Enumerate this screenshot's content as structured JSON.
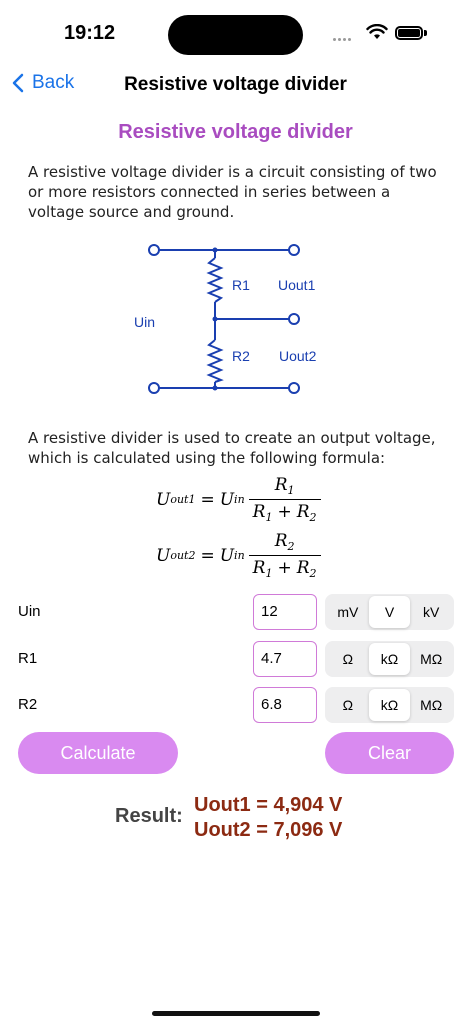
{
  "status": {
    "time": "19:12"
  },
  "nav": {
    "back_label": "Back",
    "title": "Resistive voltage divider"
  },
  "content": {
    "heading": "Resistive voltage divider",
    "intro": "A resistive voltage divider is a circuit consisting of two or more resistors connected in series between a voltage source and ground.",
    "diagram": {
      "uin_label": "Uin",
      "r1_label": "R1",
      "r2_label": "R2",
      "uout1_label": "Uout1",
      "uout2_label": "Uout2",
      "color": "#1a3fb0"
    },
    "formula_intro": "A resistive divider is used to create an output voltage, which is calculated using the following formula:",
    "formula1": {
      "lhs": "U",
      "lhs_sub": "out1",
      "rhs": "U",
      "rhs_sub": "in",
      "num": "R",
      "num_sub": "1",
      "den_a": "R",
      "den_a_sub": "1",
      "den_plus": "+",
      "den_b": "R",
      "den_b_sub": "2"
    },
    "formula2": {
      "lhs": "U",
      "lhs_sub": "out2",
      "rhs": "U",
      "rhs_sub": "in",
      "num": "R",
      "num_sub": "2",
      "den_a": "R",
      "den_a_sub": "1",
      "den_plus": "+",
      "den_b": "R",
      "den_b_sub": "2"
    }
  },
  "inputs": {
    "uin": {
      "label": "Uin",
      "value": "12",
      "units": [
        "mV",
        "V",
        "kV"
      ],
      "selected_unit": "V"
    },
    "r1": {
      "label": "R1",
      "value": "4.7",
      "units": [
        "Ω",
        "kΩ",
        "MΩ"
      ],
      "selected_unit": "kΩ"
    },
    "r2": {
      "label": "R2",
      "value": "6.8",
      "units": [
        "Ω",
        "kΩ",
        "MΩ"
      ],
      "selected_unit": "kΩ"
    }
  },
  "buttons": {
    "calculate": "Calculate",
    "clear": "Clear"
  },
  "result": {
    "label": "Result:",
    "uout1": "Uout1 = 4,904 V",
    "uout2": "Uout2 = 7,096 V"
  },
  "colors": {
    "accent": "#a94cc0",
    "button": "#d98af0",
    "result": "#8c2a12",
    "link": "#1a73e8"
  }
}
